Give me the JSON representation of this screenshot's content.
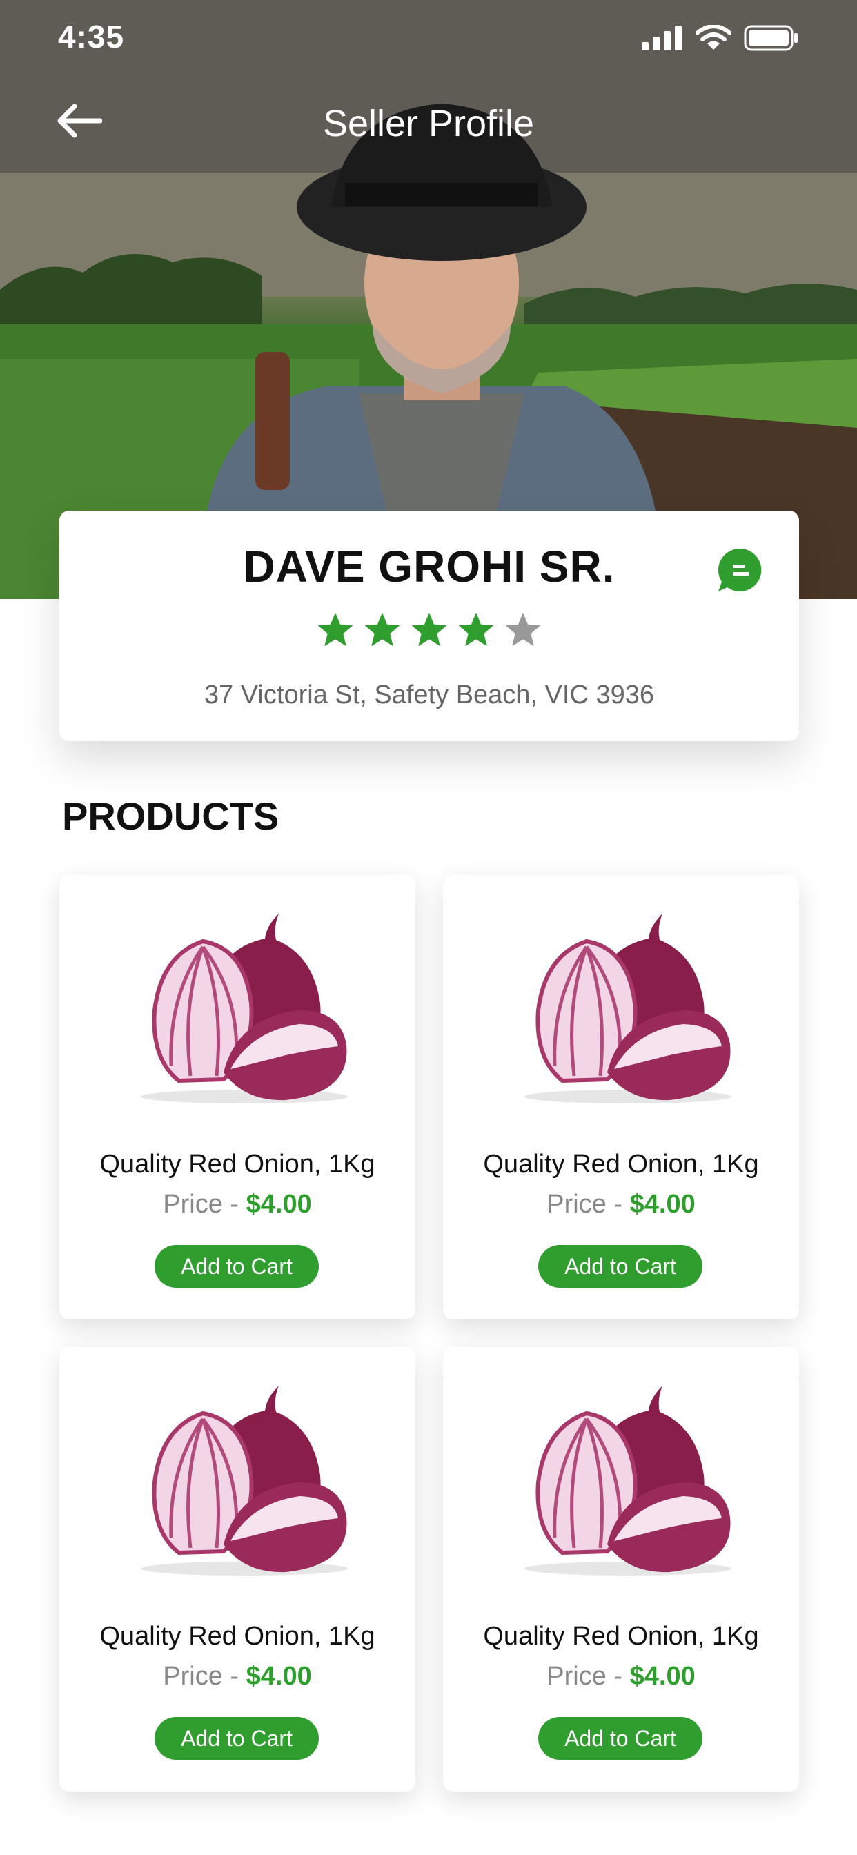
{
  "status_bar": {
    "time": "4:35"
  },
  "nav": {
    "title": "Seller Profile"
  },
  "seller": {
    "name": "DAVE GROHI SR.",
    "rating": 4,
    "rating_max": 5,
    "address": "37 Victoria St, Safety Beach, VIC 3936"
  },
  "section": {
    "title": "PRODUCTS"
  },
  "products": [
    {
      "name": "Quality Red Onion, 1Kg",
      "price_label": "Price - ",
      "price": "$4.00",
      "button": "Add to Cart"
    },
    {
      "name": "Quality Red Onion, 1Kg",
      "price_label": "Price - ",
      "price": "$4.00",
      "button": "Add to Cart"
    },
    {
      "name": "Quality Red Onion, 1Kg",
      "price_label": "Price - ",
      "price": "$4.00",
      "button": "Add to Cart"
    },
    {
      "name": "Quality Red Onion, 1Kg",
      "price_label": "Price - ",
      "price": "$4.00",
      "button": "Add to Cart"
    }
  ],
  "colors": {
    "accent": "#2f9e2f",
    "star_filled": "#2f9e2f",
    "star_empty": "#999999",
    "text_dark": "#111111",
    "text_muted": "#666666"
  },
  "icons": {
    "back": "arrow-left-icon",
    "chat": "chat-bubble-icon",
    "signal": "cellular-signal-icon",
    "wifi": "wifi-icon",
    "battery": "battery-icon",
    "star": "star-icon"
  }
}
